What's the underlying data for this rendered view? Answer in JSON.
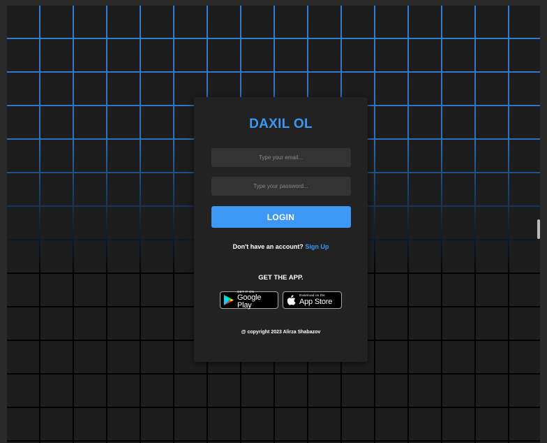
{
  "login": {
    "title": "DAXIL OL",
    "email_placeholder": "Type your email...",
    "password_placeholder": "Type your password...",
    "login_label": "LOGIN",
    "no_account_text": "Don't have an account?",
    "signup_link": "Sign Up",
    "get_app_text": "GET THE APP.",
    "google_play": {
      "small": "GET IT ON",
      "big": "Google Play",
      "icon": "google-play-icon"
    },
    "app_store": {
      "small": "Download on the",
      "big": "App Store",
      "icon": "apple-icon"
    },
    "copyright": "@ copyright 2023 Alirza Shabazov"
  },
  "colors": {
    "accent": "#3d97f5",
    "card_bg": "#222222",
    "field_bg": "#333333",
    "grid_blue": "#2f7fd8",
    "page_bg": "#1d1d1d"
  }
}
